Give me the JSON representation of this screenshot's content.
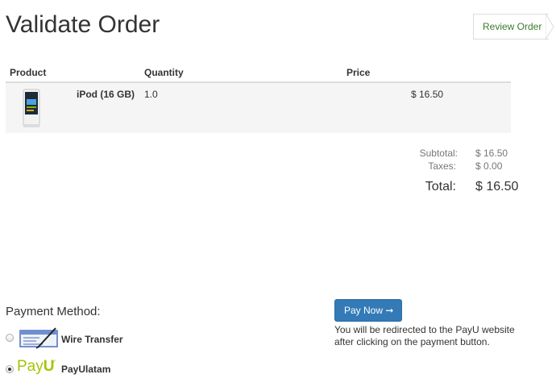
{
  "page": {
    "title": "Validate Order"
  },
  "breadcrumb": {
    "step_label": "Review Order",
    "accent_color": "#3a7a2f"
  },
  "table": {
    "headers": {
      "product": "Product",
      "quantity": "Quantity",
      "price": "Price"
    },
    "rows": [
      {
        "thumbnail_icon": "ipod-thumbnail-icon",
        "name": "iPod (16 GB)",
        "quantity": "1.0",
        "price": "$ 16.50"
      }
    ]
  },
  "totals": {
    "subtotal_label": "Subtotal:",
    "subtotal_value": "$ 16.50",
    "taxes_label": "Taxes:",
    "taxes_value": "$ 0.00",
    "total_label": "Total:",
    "total_value": "$ 16.50"
  },
  "payment": {
    "heading": "Payment Method:",
    "methods": [
      {
        "label": "Wire Transfer",
        "icon": "wire-transfer-icon",
        "selected": false
      },
      {
        "label": "PayUlatam",
        "icon": "payu-logo",
        "logo_text_a": "Pay",
        "logo_text_b": "U",
        "selected": true
      }
    ],
    "button_label": "Pay Now",
    "button_icon": "arrow-right-icon",
    "button_color": "#337ab7",
    "note": "You will be redirected to the PayU website after clicking on the payment button."
  }
}
